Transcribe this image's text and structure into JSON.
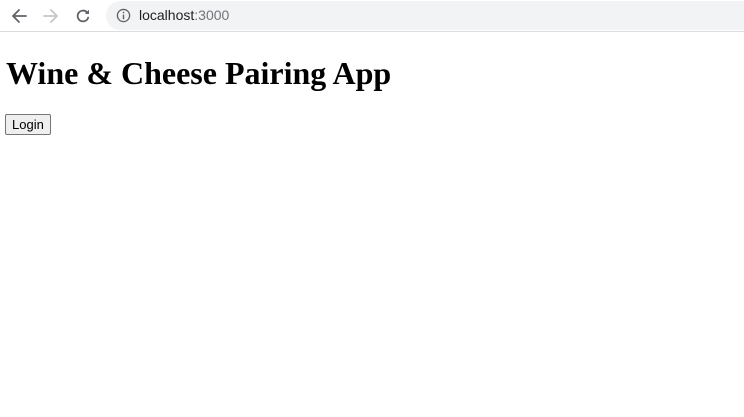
{
  "browser": {
    "url_host": "localhost",
    "url_port": ":3000",
    "icons": {
      "back": "arrow-left-icon",
      "forward": "arrow-right-icon",
      "reload": "reload-icon",
      "site_info": "info-icon"
    }
  },
  "page": {
    "title": "Wine & Cheese Pairing App",
    "login_label": "Login"
  }
}
